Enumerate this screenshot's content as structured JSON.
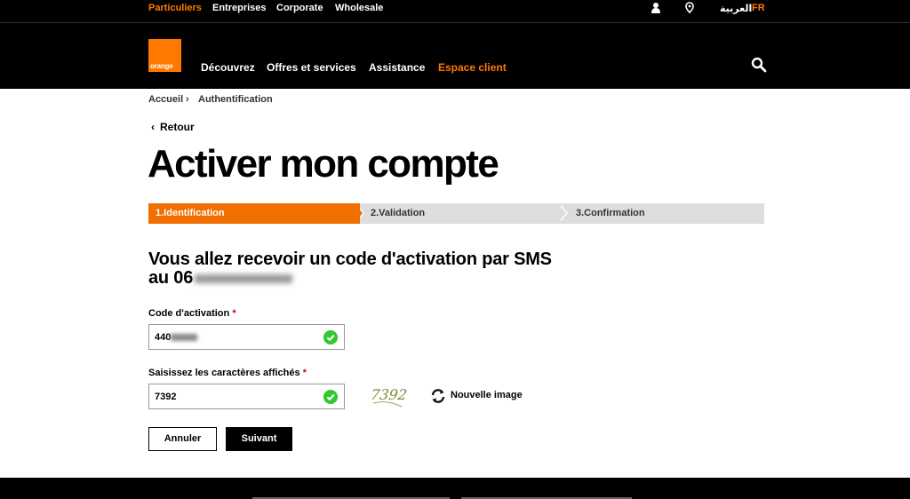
{
  "topbar": {
    "segments": [
      "Particuliers",
      "Entreprises",
      "Corporate",
      "Wholesale"
    ],
    "lang_ar": "العربية",
    "lang_fr": "FR"
  },
  "header": {
    "logo_text": "orange",
    "nav": [
      "Découvrez",
      "Offres et services",
      "Assistance",
      "Espace client"
    ]
  },
  "breadcrumb": [
    "Accueil",
    "Authentification"
  ],
  "back_label": "Retour",
  "page_title": "Activer mon compte",
  "steps": [
    "1.Identification",
    "2.Validation",
    "3.Confirmation"
  ],
  "subheading": "Vous allez recevoir un code d'activation par SMS au 06",
  "form": {
    "code_label": "Code d'activation",
    "code_value": "440",
    "captcha_label": "Saisissez les caractères affichés",
    "captcha_value": "7392",
    "required_mark": "*",
    "captcha_image_text": "7392",
    "new_image_label": "Nouvelle image"
  },
  "buttons": {
    "cancel": "Annuler",
    "next": "Suivant"
  },
  "colors": {
    "accent": "#ff7900",
    "step_active": "#f16e00",
    "step_inactive": "#dddddd",
    "valid": "#32c832"
  }
}
